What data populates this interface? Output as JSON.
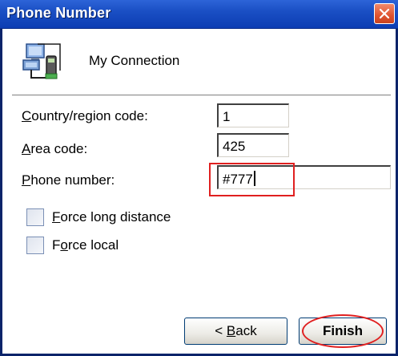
{
  "window": {
    "title": "Phone Number",
    "close_icon": "close-icon"
  },
  "connection": {
    "icon": "network-connection-icon",
    "name": "My Connection"
  },
  "fields": {
    "country_code": {
      "label_mnemonic": "C",
      "label_rest": "ountry/region code:",
      "value": "1"
    },
    "area_code": {
      "label_mnemonic": "A",
      "label_rest": "rea code:",
      "value": "425"
    },
    "phone_number": {
      "label_mnemonic": "P",
      "label_rest": "hone number:",
      "value": "#777"
    }
  },
  "options": {
    "force_long_distance": {
      "label_mnemonic": "F",
      "label_rest": "orce long distance",
      "checked": false
    },
    "force_local": {
      "label_before": "F",
      "label_mnemonic": "o",
      "label_rest": "rce local",
      "checked": false
    }
  },
  "buttons": {
    "back_prefix": "< ",
    "back_mnemonic": "B",
    "back_rest": "ack",
    "finish": "Finish"
  },
  "colors": {
    "titlebar": "#1a4fc4",
    "annotation": "#e02020"
  }
}
